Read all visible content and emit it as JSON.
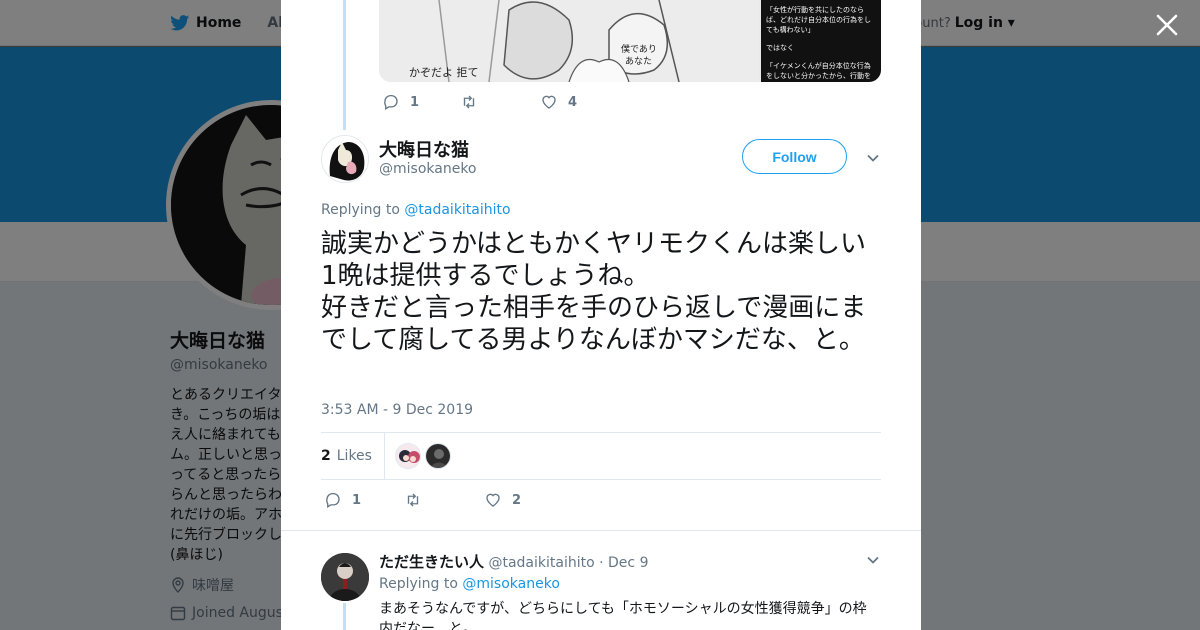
{
  "topbar": {
    "home_label": "Home",
    "about_label": "Abo",
    "account_prompt": "ccount?",
    "login_label": "Log in"
  },
  "profile": {
    "name": "大晦日な猫",
    "handle": "@misokaneko",
    "bio_lines": [
      "とあるクリエイタ",
      "き。こっちの垢は",
      "え人に絡まれても",
      "ム。正しいと思っ",
      "ってると思ったら",
      "らんと思ったらわ",
      "れだけの垢。アホ",
      "に先行ブロックし",
      "(鼻ほじ)"
    ],
    "location": "味噌屋",
    "joined": "Joined August"
  },
  "previous_tweet_actions": {
    "replies": "1",
    "retweets": "",
    "likes": "4"
  },
  "media_text": {
    "right_panel_lines": [
      "「女性が行動を共にしたのなら",
      "ば、どれだけ自分本位の行為をし",
      "ても構わない」",
      "ではなく",
      "「イケメンくんが自分本位な行為",
      "をしないと分かったから、行動を"
    ]
  },
  "tweet": {
    "name": "大晦日な猫",
    "handle": "@misokaneko",
    "follow_label": "Follow",
    "replying_prefix": "Replying to",
    "replying_handle": "@tadaikitaihito",
    "text": "誠実かどうかはともかくヤリモクくんは楽しい1晩は提供するでしょうね。\n好きだと言った相手を手のひら返しで漫画にまでして腐してる男よりなんぼかマシだな、と。",
    "timestamp": "3:53 AM - 9 Dec 2019",
    "likes_count": "2",
    "likes_label": "Likes",
    "actions": {
      "replies": "1",
      "retweets": "",
      "likes": "2"
    }
  },
  "reply": {
    "name": "ただ生きたい人",
    "handle": "@tadaikitaihito",
    "separator": "·",
    "date": "Dec 9",
    "replying_prefix": "Replying to",
    "replying_handle": "@misokaneko",
    "text": "まあそうなんですが、どちらにしても「ホモソーシャルの女性獲得競争」の枠内だなー、と。"
  },
  "colors": {
    "accent": "#1da1f2",
    "link": "#1b95e0",
    "banner": "#1b95e0",
    "thread_line": "#c4dff0",
    "muted": "#657786"
  },
  "icons": [
    "twitter-bird-icon",
    "close-icon",
    "reply-icon",
    "retweet-icon",
    "like-icon",
    "chevron-down-icon",
    "location-icon",
    "calendar-icon"
  ]
}
